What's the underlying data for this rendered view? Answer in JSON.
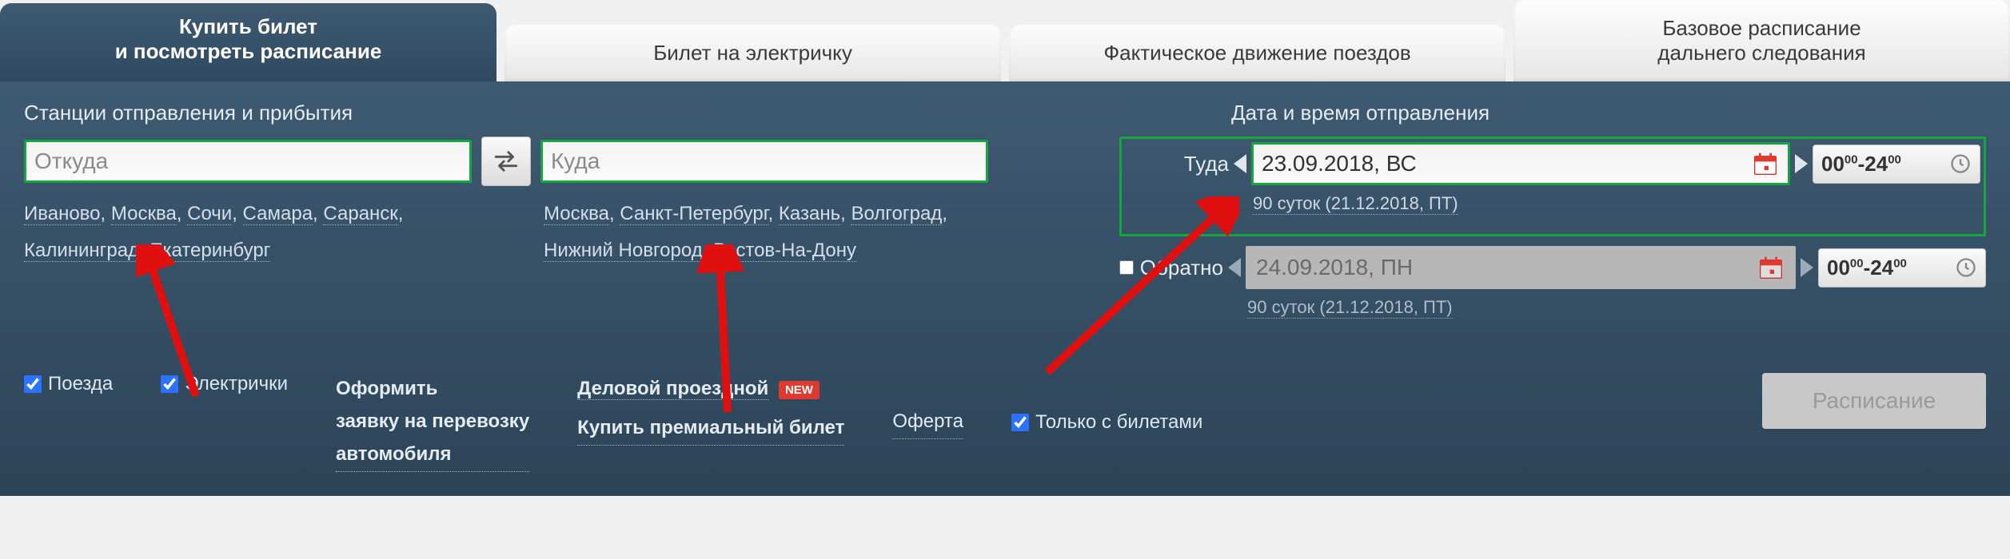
{
  "tabs": [
    "Купить билет\nи посмотреть расписание",
    "Билет на электричку",
    "Фактическое движение поездов",
    "Базовое расписание\nдальнего следования"
  ],
  "stations": {
    "title": "Станции отправления и прибытия",
    "from_placeholder": "Откуда",
    "to_placeholder": "Куда",
    "from_suggest": [
      "Иваново",
      "Москва",
      "Сочи",
      "Самара",
      "Саранск",
      "Калининград",
      "Екатеринбург"
    ],
    "to_suggest": [
      "Москва",
      "Санкт-Петербург",
      "Казань",
      "Волгоград",
      "Нижний Новгород",
      "Ростов-На-Дону"
    ]
  },
  "dates": {
    "title": "Дата и время отправления",
    "to_label": "Туда",
    "back_label": "Обратно",
    "to_date": "23.09.2018, ВС",
    "back_date": "24.09.2018, ПН",
    "hint": "90 суток (21.12.2018, ПТ)",
    "time_from": "00",
    "time_from_min": "00",
    "time_to": "24",
    "time_to_min": "00"
  },
  "bottom": {
    "trains": "Поезда",
    "elektr": "Электрички",
    "auto_request": "Оформить\nзаявку на перевозку\nавтомобиля",
    "business": "Деловой проездной",
    "new_badge": "NEW",
    "premium": "Купить премиальный билет",
    "oferta": "Оферта",
    "tickets_only": "Только с билетами",
    "schedule_btn": "Расписание"
  },
  "colors": {
    "accent_green": "#15a63f",
    "panel_bg": "#3e5a71",
    "badge_red": "#e03a2f"
  }
}
